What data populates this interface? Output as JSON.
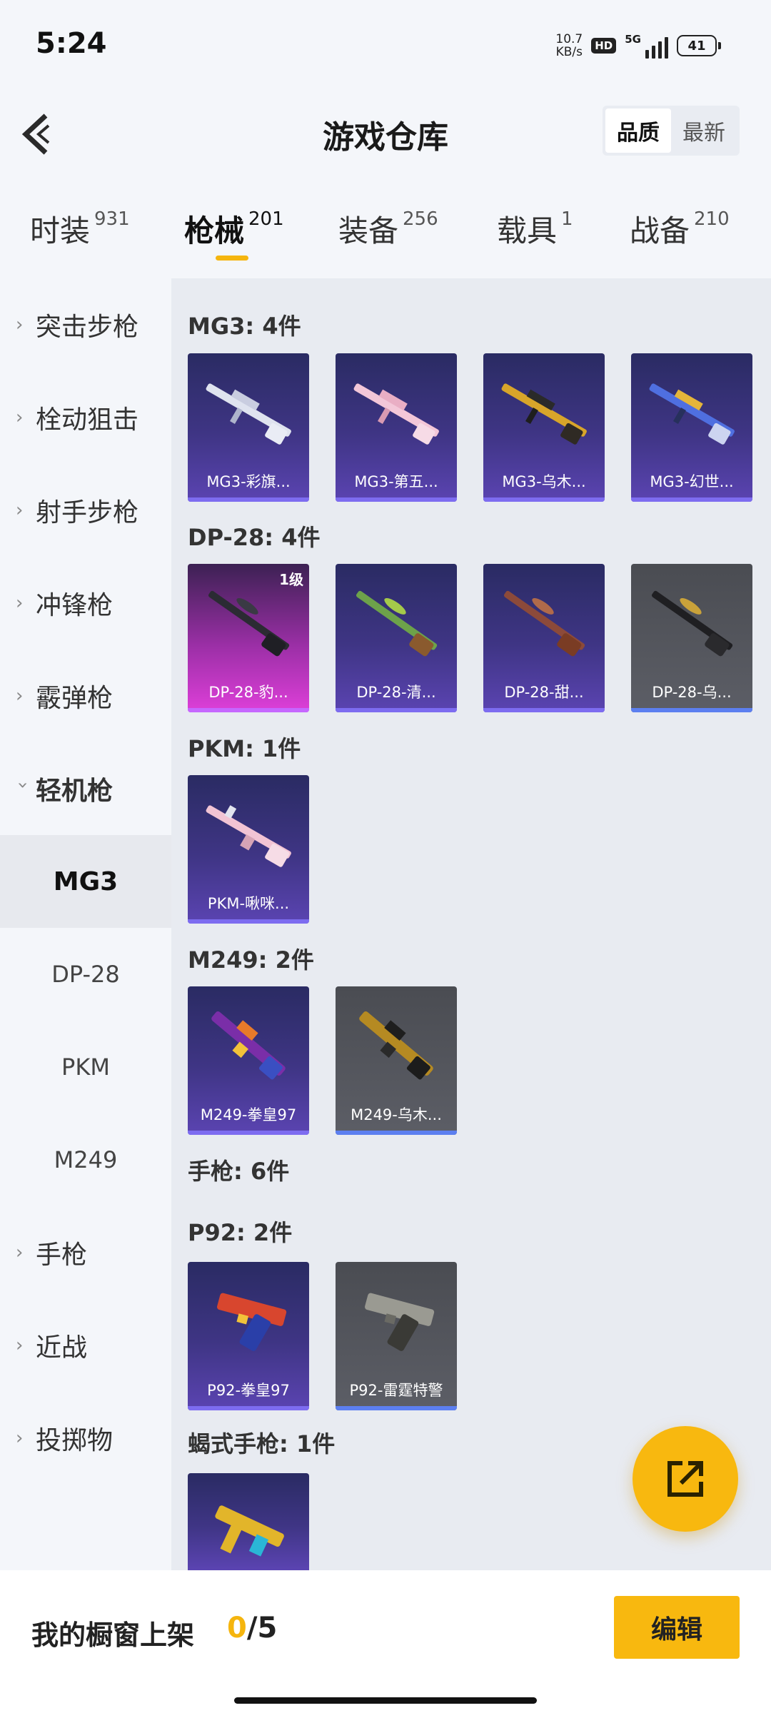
{
  "status_bar": {
    "time": "5:24",
    "net_speed_value": "10.7",
    "net_speed_unit": "KB/s",
    "hd": "HD",
    "network": "5G",
    "battery": "41"
  },
  "header": {
    "title": "游戏仓库",
    "sort_quality": "品质",
    "sort_newest": "最新"
  },
  "tabs": [
    {
      "label": "时装",
      "count": "931"
    },
    {
      "label": "枪械",
      "count": "201"
    },
    {
      "label": "装备",
      "count": "256"
    },
    {
      "label": "载具",
      "count": "1"
    },
    {
      "label": "战备",
      "count": "210"
    }
  ],
  "sidebar": {
    "categories": [
      "突击步枪",
      "栓动狙击",
      "射手步枪",
      "冲锋枪",
      "霰弹枪",
      "轻机枪"
    ],
    "subitems": [
      "MG3",
      "DP-28",
      "PKM",
      "M249"
    ],
    "more": [
      "手枪",
      "近战",
      "投掷物"
    ]
  },
  "groups": {
    "mg3": {
      "title": "MG3: 4件",
      "items": [
        "MG3-彩旗...",
        "MG3-第五...",
        "MG3-乌木...",
        "MG3-幻世..."
      ]
    },
    "dp28": {
      "title": "DP-28: 4件",
      "items": [
        "DP-28-豹...",
        "DP-28-清...",
        "DP-28-甜...",
        "DP-28-乌..."
      ],
      "level": "1级"
    },
    "pkm": {
      "title": "PKM: 1件",
      "items": [
        "PKM-啾咪..."
      ]
    },
    "m249": {
      "title": "M249: 2件",
      "items": [
        "M249-拳皇97",
        "M249-乌木..."
      ]
    },
    "pistol": {
      "title": "手枪: 6件"
    },
    "p92": {
      "title": "P92: 2件",
      "items": [
        "P92-拳皇97",
        "P92-雷霆特警"
      ]
    },
    "scorpion": {
      "title": "蝎式手枪: 1件"
    }
  },
  "bottom": {
    "label": "我的橱窗上架",
    "current": "0",
    "total": "/5",
    "edit": "编辑"
  },
  "colors": {
    "accent": "#f8b80f",
    "card_purple": "#3f3585",
    "card_pink": "#de3fd9",
    "card_gray": "#5c5e66"
  }
}
